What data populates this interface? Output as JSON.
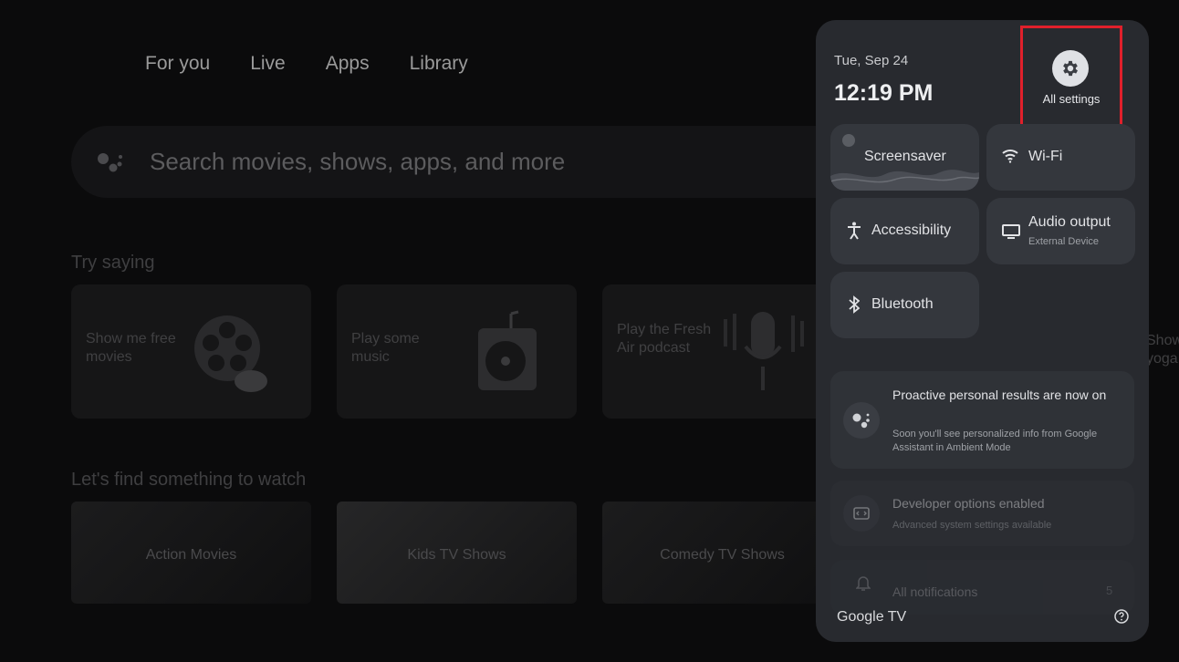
{
  "nav": {
    "tabs": [
      "For you",
      "Live",
      "Apps",
      "Library"
    ]
  },
  "search": {
    "placeholder": "Search movies, shows, apps, and more",
    "icon": "google-assistant-icon"
  },
  "try_saying": {
    "title": "Try saying",
    "cards": [
      {
        "text": "Show me free movies",
        "icon": "film-reel-icon"
      },
      {
        "text": "Play some music",
        "icon": "turntable-icon"
      },
      {
        "text": "Play the Fresh Air podcast",
        "icon": "microphone-icon"
      }
    ],
    "peek_text": "Show yoga"
  },
  "watch": {
    "title": "Let's find something to watch",
    "cards": [
      "Action Movies",
      "Kids TV Shows",
      "Comedy TV Shows"
    ]
  },
  "panel": {
    "date": "Tue, Sep 24",
    "time": "12:19 PM",
    "all_settings": "All settings",
    "tiles": {
      "screensaver": "Screensaver",
      "wifi": "Wi-Fi",
      "accessibility": "Accessibility",
      "audio_output": "Audio output",
      "audio_output_sub": "External Device",
      "bluetooth": "Bluetooth"
    },
    "notifications": [
      {
        "title": "Proactive personal results are now on",
        "body": "Soon you'll see personalized info from Google Assistant in Ambient Mode"
      },
      {
        "title": "Developer options enabled",
        "body": "Advanced system settings available"
      },
      {
        "title": "All notifications",
        "count": "5"
      }
    ],
    "brand": "Google TV",
    "colors": {
      "panel": "#282a2f",
      "tile": "#34373d",
      "highlight": "#e0202b"
    }
  }
}
